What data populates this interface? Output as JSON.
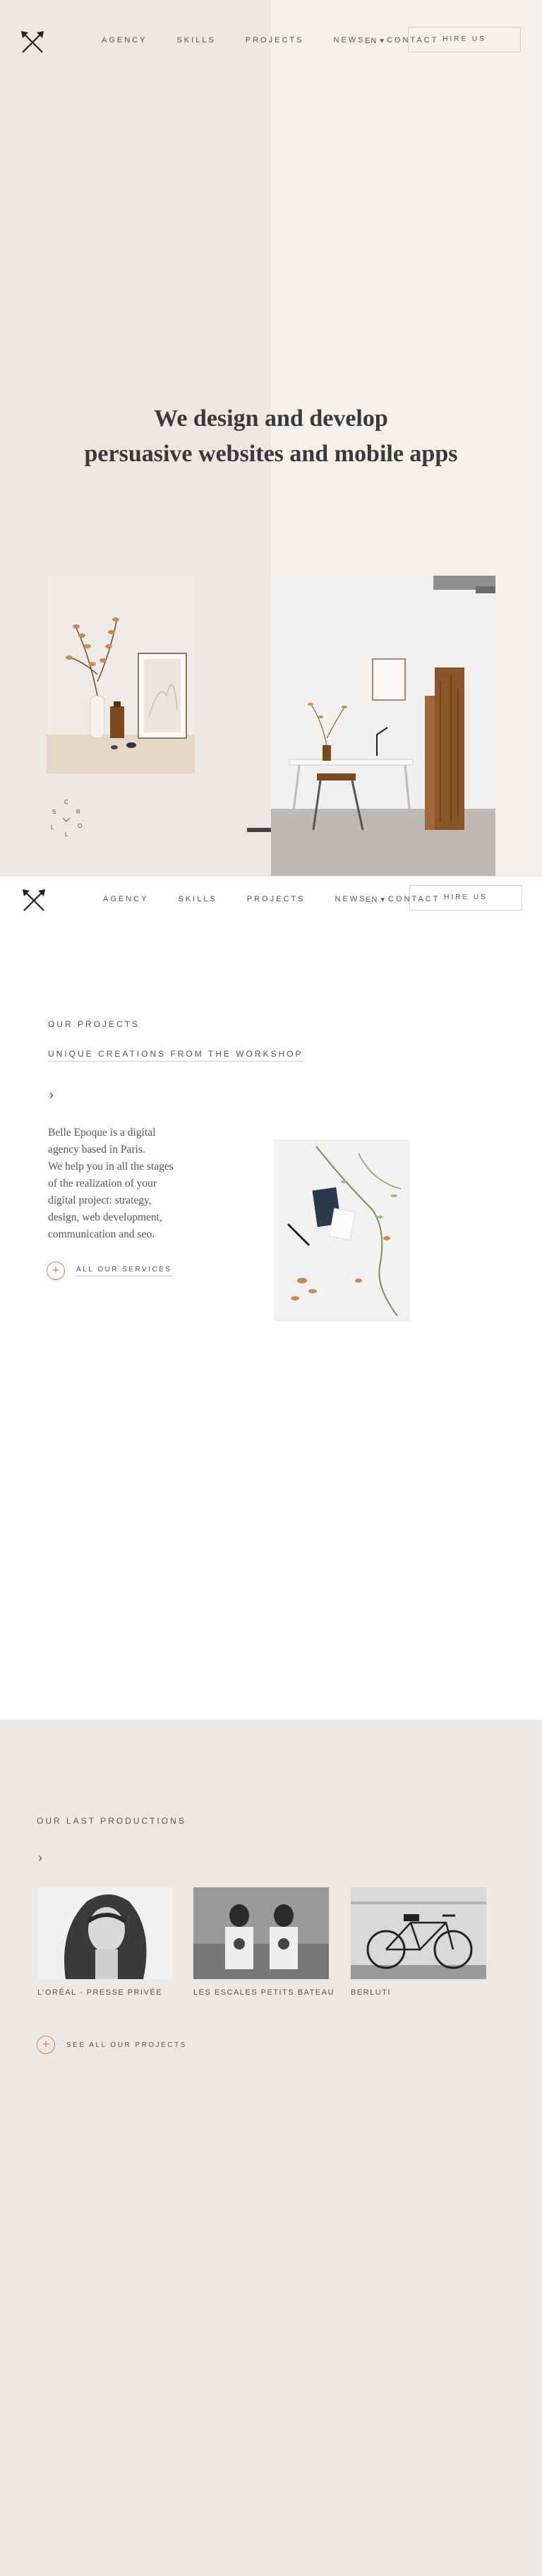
{
  "nav": {
    "links": [
      "AGENCY",
      "SKILLS",
      "PROJECTS",
      "NEWS"
    ],
    "lang": "EN ▾",
    "contact": "CONTACT",
    "hire": "HIRE US"
  },
  "hero": {
    "title_line1": "We design and develop",
    "title_line2": "persuasive websites and mobile apps",
    "scroll_letters": [
      "S",
      "C",
      "R",
      "O",
      "L",
      "L"
    ]
  },
  "projects": {
    "eyebrow": "OUR PROJECTS",
    "subtitle": "UNIQUE CREATIONS FROM THE WORKSHOP",
    "arrow": "›",
    "intro_lines": [
      "Belle Epoque is a digital",
      "agency based in Paris.",
      "We help you in all the stages",
      "of the realization of your",
      "digital project: strategy,",
      "design, web development,",
      "communication and seo."
    ],
    "services_link": "ALL OUR SERVICES"
  },
  "productions": {
    "heading": "OUR LAST PRODUCTIONS",
    "arrow": "›",
    "items": [
      {
        "caption": "L’ORÉAL - PRESSE PRIVÉE"
      },
      {
        "caption": "LES ESCALES PETITS BATEAU"
      },
      {
        "caption": "BERLUTI"
      }
    ],
    "see_all": "SEE ALL OUR PROJECTS"
  },
  "colors": {
    "accent": "#c98b60",
    "hero_left": "#ece7e4",
    "hero_right": "#f3f0ee",
    "productions_bg": "#ece8e5"
  }
}
